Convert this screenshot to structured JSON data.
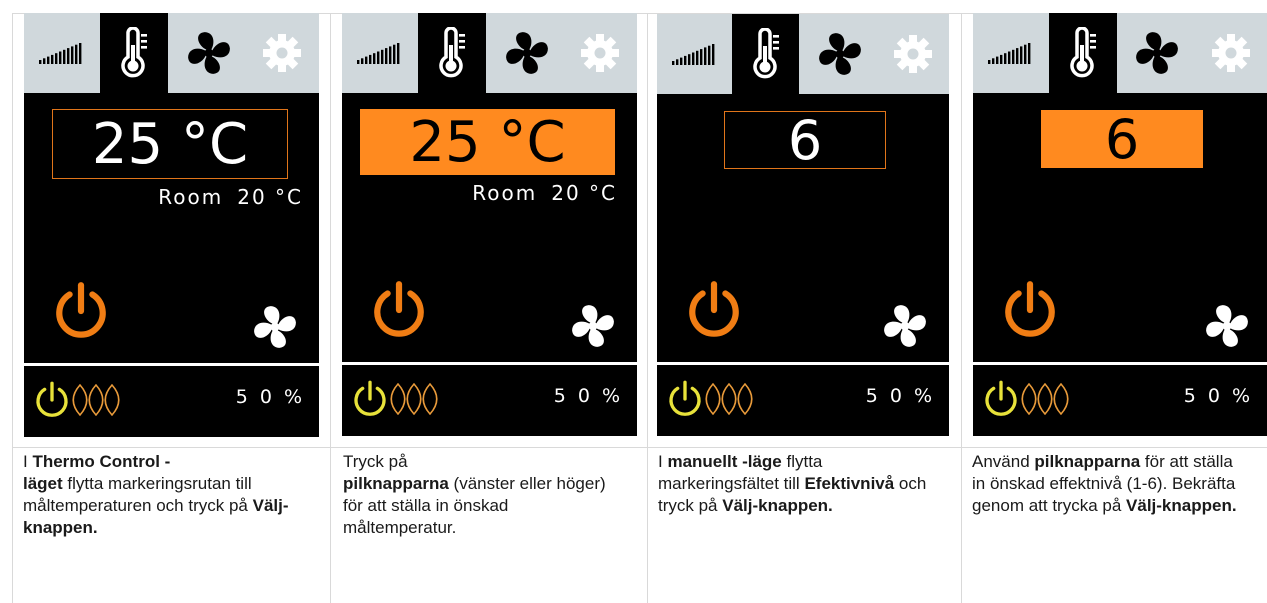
{
  "panels": [
    {
      "target_value": "25 °C",
      "target_highlighted": false,
      "room_label": "Room",
      "room_value": "20 °C",
      "power_percent": "5 0  %",
      "caption": [
        {
          "text": "I ",
          "bold": false
        },
        {
          "text": "Thermo Control -",
          "bold": true
        },
        {
          "text": "\n",
          "bold": false
        },
        {
          "text": "läget",
          "bold": true
        },
        {
          "text": " flytta markeringsrutan till måltemperaturen och tryck på ",
          "bold": false
        },
        {
          "text": "Välj-knappen.",
          "bold": true
        }
      ]
    },
    {
      "target_value": "25 °C",
      "target_highlighted": true,
      "room_label": "Room",
      "room_value": "20 °C",
      "power_percent": "5 0  %",
      "caption": [
        {
          "text": "Tryck på",
          "bold": false
        },
        {
          "text": "\n",
          "bold": false
        },
        {
          "text": "pilknapparna",
          "bold": true
        },
        {
          "text": " (vänster eller höger) för att ställa in önskad måltemperatur.",
          "bold": false
        }
      ]
    },
    {
      "target_value": "6",
      "target_highlighted": false,
      "room_label": "",
      "room_value": "",
      "power_percent": "5 0  %",
      "caption": [
        {
          "text": "I ",
          "bold": false
        },
        {
          "text": "manuellt -läge",
          "bold": true
        },
        {
          "text": " flytta markeringsfältet till ",
          "bold": false
        },
        {
          "text": "Efektivnivå",
          "bold": true
        },
        {
          "text": " och tryck på ",
          "bold": false
        },
        {
          "text": "Välj-knappen.",
          "bold": true
        }
      ]
    },
    {
      "target_value": "6",
      "target_highlighted": true,
      "room_label": "",
      "room_value": "",
      "power_percent": "5 0  %",
      "caption": [
        {
          "text": "Använd ",
          "bold": false
        },
        {
          "text": "pilknapparna",
          "bold": true
        },
        {
          "text": " för att ställa in önskad effektnivå (1-6). Bekräfta genom att trycka på ",
          "bold": false
        },
        {
          "text": "Välj-knappen.",
          "bold": true
        }
      ]
    }
  ],
  "icons": {
    "tabs": [
      "signal-bars-icon",
      "thermometer-icon",
      "fan-icon",
      "gear-icon"
    ],
    "power": "power-icon",
    "fan_button": "fan-icon",
    "footer_power": "power-icon",
    "footer_heat": "heat-waves-icon"
  },
  "colors": {
    "screen_bg": "#000000",
    "tabbar_bg": "#d0d8dc",
    "accent_orange": "#ff8a1f",
    "power_orange": "#f07d14",
    "footer_yellow": "#e8e23a",
    "heat_orange": "#e89a3a"
  }
}
